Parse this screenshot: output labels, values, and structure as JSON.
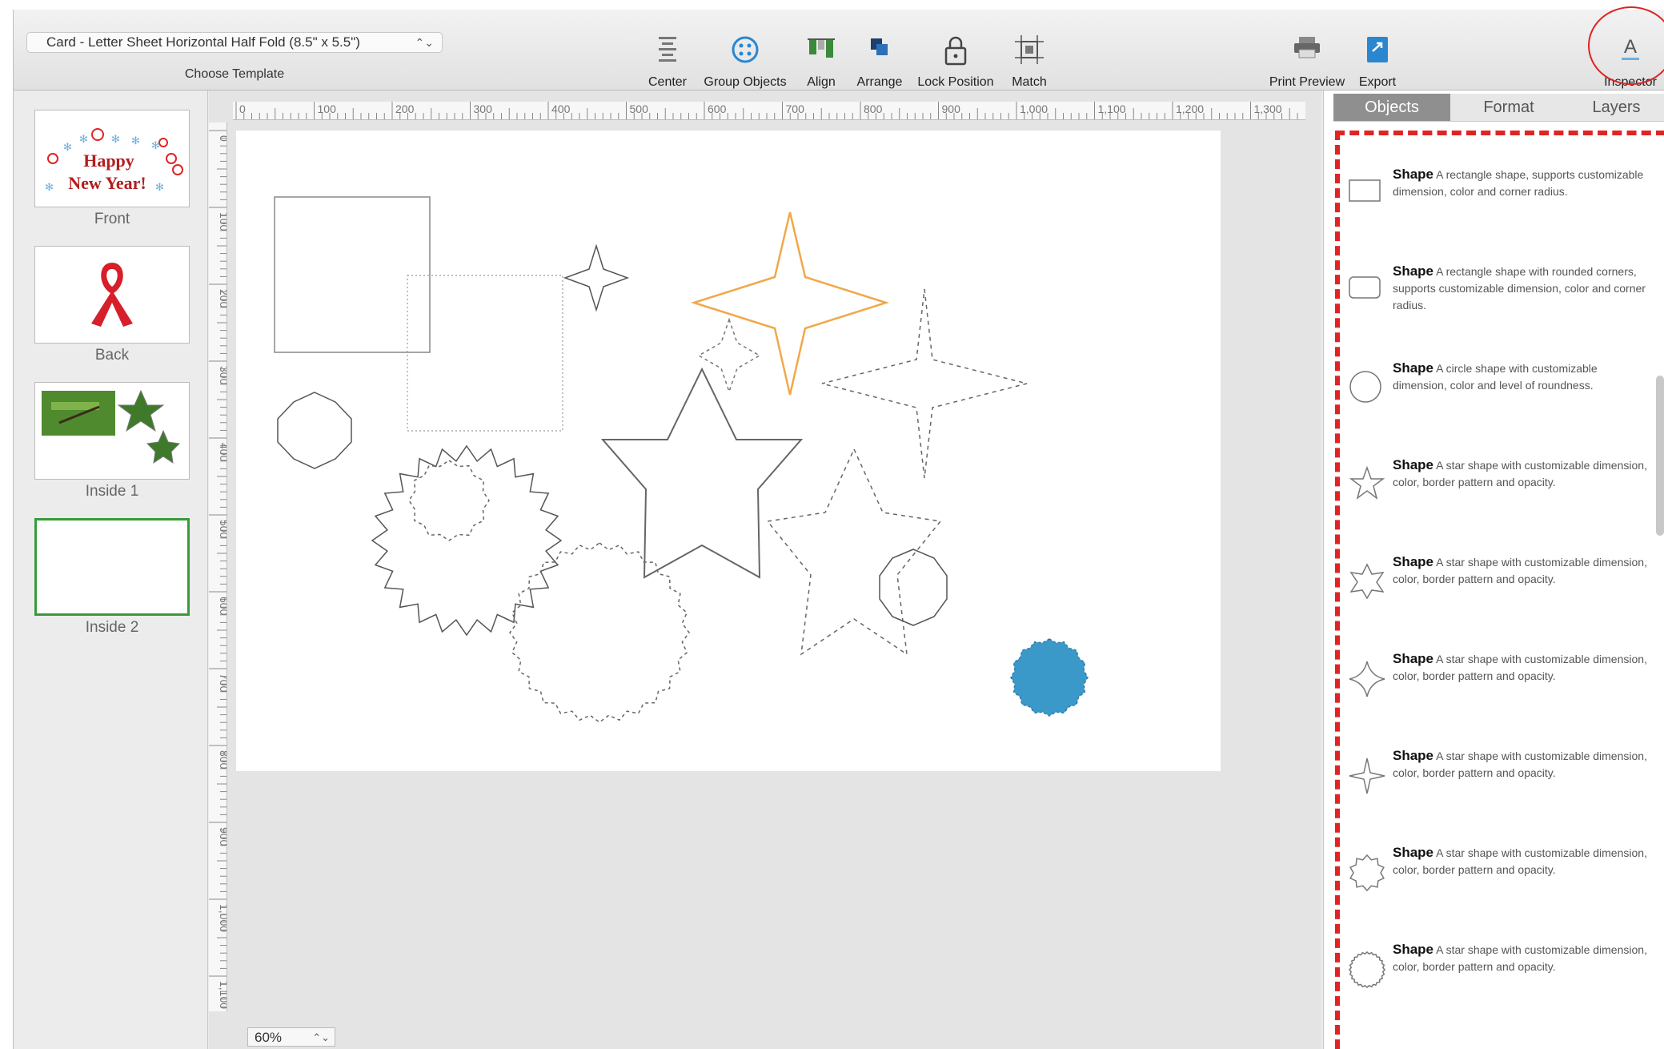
{
  "toolbar": {
    "template_value": "Card - Letter Sheet Horizontal Half Fold (8.5\" x 5.5\")",
    "template_caption": "Choose Template",
    "buttons": [
      {
        "label": "Center",
        "icon": "align-center-icon"
      },
      {
        "label": "Group Objects",
        "icon": "group-objects-icon"
      },
      {
        "label": "Align",
        "icon": "align-icon"
      },
      {
        "label": "Arrange",
        "icon": "arrange-icon"
      },
      {
        "label": "Lock Position",
        "icon": "lock-icon"
      },
      {
        "label": "Match",
        "icon": "match-icon"
      },
      {
        "label": "Print Preview",
        "icon": "printer-icon"
      },
      {
        "label": "Export",
        "icon": "export-icon"
      },
      {
        "label": "Inspector",
        "icon": "inspector-icon"
      }
    ]
  },
  "thumbnails": [
    {
      "label": "Front",
      "text1": "Happy",
      "text2": "New Year!"
    },
    {
      "label": "Back"
    },
    {
      "label": "Inside 1"
    },
    {
      "label": "Inside 2",
      "selected": true
    }
  ],
  "rulers": {
    "horizontal": [
      "0",
      "100",
      "200",
      "300",
      "400",
      "500",
      "600",
      "700",
      "800",
      "900",
      "1,000",
      "1,100",
      "1,200",
      "1,300"
    ],
    "vertical": [
      "0",
      "100",
      "200",
      "300",
      "400",
      "500",
      "600",
      "700",
      "800",
      "900",
      "1,000",
      "1,100"
    ]
  },
  "zoom": "60%",
  "inspector": {
    "tabs": [
      "Objects",
      "Format",
      "Layers"
    ],
    "active_tab": "Objects",
    "items": [
      {
        "title": "Shape",
        "desc": "A rectangle shape, supports customizable dimension, color and corner radius.",
        "icon": "rectangle-icon"
      },
      {
        "title": "Shape",
        "desc": "A rectangle shape with rounded corners, supports customizable dimension, color and corner radius.",
        "icon": "rounded-rectangle-icon"
      },
      {
        "title": "Shape",
        "desc": "A circle shape with customizable dimension, color and level of roundness.",
        "icon": "circle-icon"
      },
      {
        "title": "Shape",
        "desc": "A star shape with customizable dimension, color, border pattern and opacity.",
        "icon": "five-point-star-icon"
      },
      {
        "title": "Shape",
        "desc": "A star shape with customizable dimension, color, border pattern and opacity.",
        "icon": "six-point-star-icon"
      },
      {
        "title": "Shape",
        "desc": "A star shape with customizable dimension, color, border pattern and opacity.",
        "icon": "diamond-star-icon"
      },
      {
        "title": "Shape",
        "desc": "A star shape with customizable dimension, color, border pattern and opacity.",
        "icon": "four-point-star-icon"
      },
      {
        "title": "Shape",
        "desc": "A star shape with customizable dimension, color, border pattern and opacity.",
        "icon": "starburst-icon"
      },
      {
        "title": "Shape",
        "desc": "A star shape with customizable dimension, color, border pattern and opacity.",
        "icon": "seal-icon"
      }
    ]
  },
  "colors": {
    "accent_blue": "#3a99c9",
    "selected_star": "#f0a84a",
    "highlight_red": "#e02424",
    "selection_green": "#3a9a3a"
  }
}
